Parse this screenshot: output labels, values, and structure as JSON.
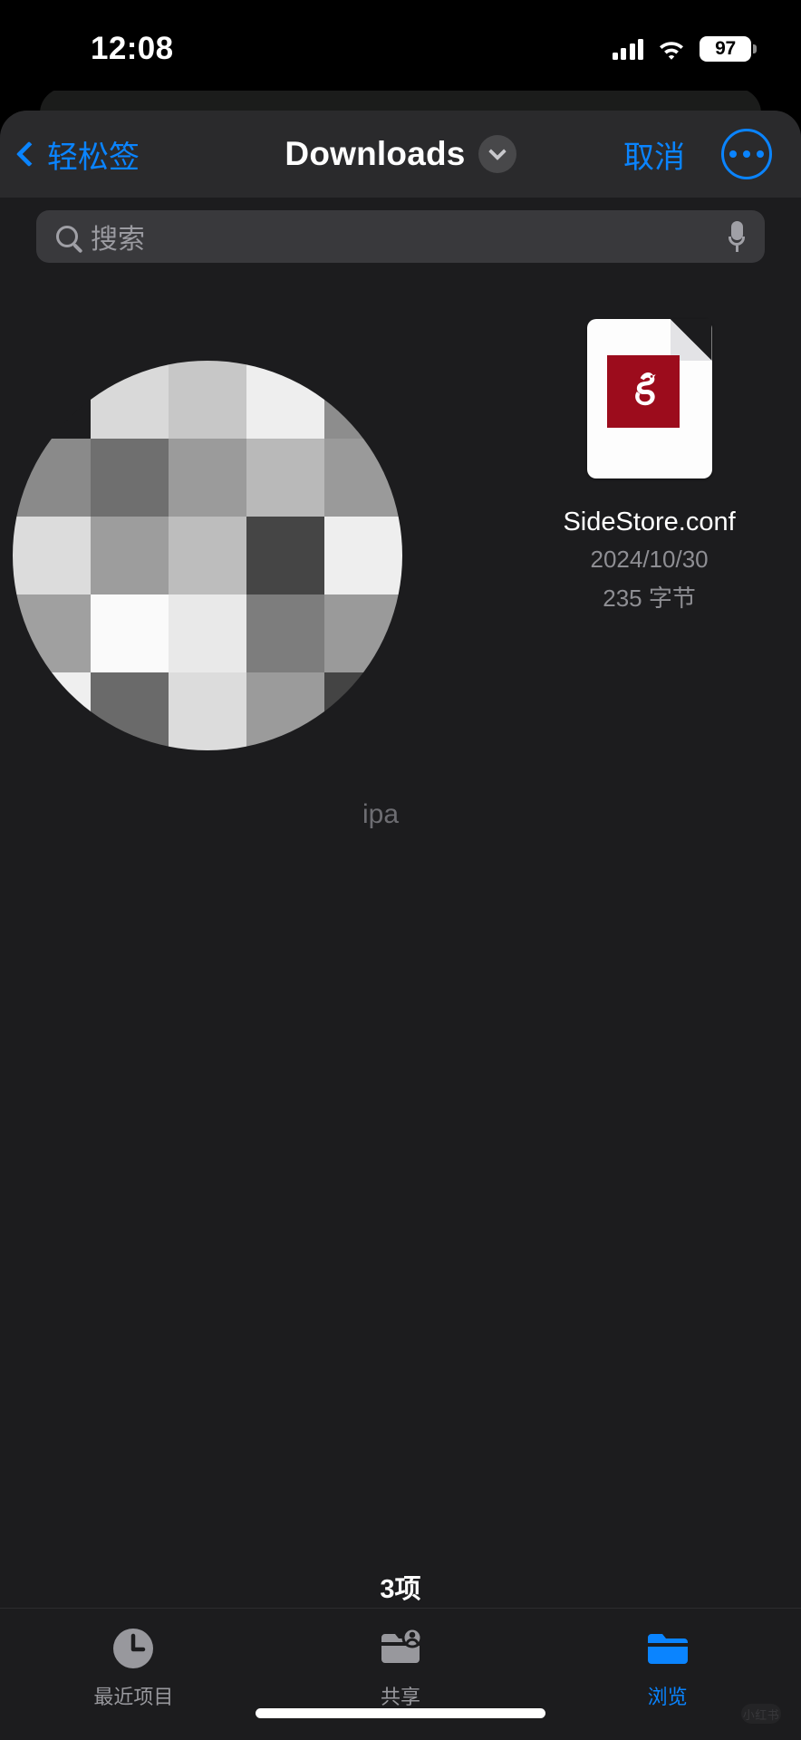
{
  "status_bar": {
    "time": "12:08",
    "battery_percent": "97",
    "signal_icon": "cellular-signal-icon",
    "wifi_icon": "wifi-icon",
    "battery_icon": "battery-icon"
  },
  "navbar": {
    "back_label": "轻松签",
    "back_icon": "chevron-left-icon",
    "title": "Downloads",
    "title_chevron_icon": "chevron-down-icon",
    "cancel_label": "取消",
    "more_icon": "ellipsis-circle-icon"
  },
  "search": {
    "placeholder": "搜索",
    "search_icon": "search-icon",
    "mic_icon": "microphone-icon"
  },
  "files": [
    {
      "name": "SideStore.conf",
      "date": "2024/10/30",
      "size": "235 字节",
      "icon": "document-file-icon",
      "badge_color": "#9c0c1c"
    }
  ],
  "redacted": {
    "hidden_label_fragment": "ipa",
    "mosaic_tiles": [
      "#1c1c1e",
      "#d9d9d9",
      "#c7c7c7",
      "#eeeeee",
      "#8d8d8d",
      "#8a8a8a",
      "#6f6f6f",
      "#9b9b9b",
      "#b9b9b9",
      "#9a9a9a",
      "#dcdcdc",
      "#9d9d9d",
      "#bdbdbd",
      "#454545",
      "#eeeeee",
      "#a0a0a0",
      "#fafafa",
      "#e9e9e9",
      "#7d7d7d",
      "#9a9a9a",
      "#efefef",
      "#6a6a6a",
      "#dcdcdc",
      "#9b9b9b",
      "#444444"
    ]
  },
  "footer": {
    "item_count": "3项"
  },
  "tabs": [
    {
      "label": "最近项目",
      "icon": "clock-icon",
      "active": false
    },
    {
      "label": "共享",
      "icon": "shared-folder-icon",
      "active": false
    },
    {
      "label": "浏览",
      "icon": "folder-icon",
      "active": true
    }
  ],
  "colors": {
    "accent": "#0a84ff",
    "sheet_bg": "#1c1c1e",
    "navbar_bg": "#2a2a2c",
    "secondary_text": "#8e8e93"
  },
  "watermark": {
    "text": "小红书"
  }
}
